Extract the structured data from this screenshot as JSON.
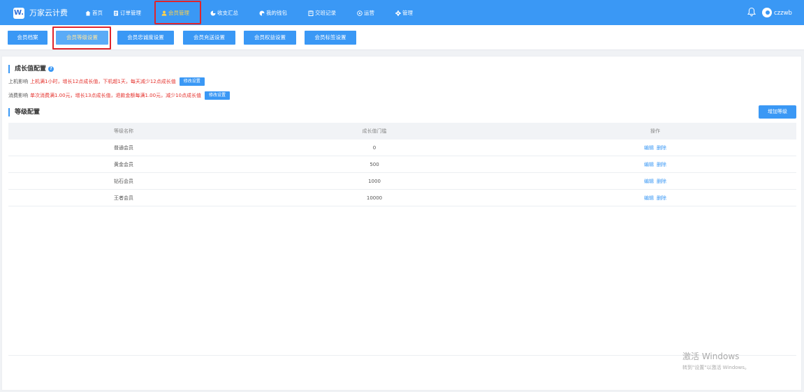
{
  "app": {
    "logo_letter": "W.",
    "name": "万家云计费"
  },
  "nav": {
    "items": [
      {
        "label": "首页",
        "icon": "home-icon"
      },
      {
        "label": "订单管理",
        "icon": "document-icon"
      },
      {
        "label": "会员管理",
        "icon": "user-icon",
        "active": true
      },
      {
        "label": "收支汇总",
        "icon": "chart-icon"
      },
      {
        "label": "我的钱包",
        "icon": "wallet-icon"
      },
      {
        "label": "交班记录",
        "icon": "clipboard-icon"
      },
      {
        "label": "运营",
        "icon": "target-icon"
      },
      {
        "label": "管理",
        "icon": "gear-icon"
      }
    ],
    "username": "czzwb",
    "accent_color": "#3a98f5",
    "active_color": "#ffd24a",
    "highlight_color": "#e0242b"
  },
  "subnav": {
    "items": [
      {
        "label": "会员档案"
      },
      {
        "label": "会员等级设置",
        "active": true
      },
      {
        "label": "会员忠诚度设置"
      },
      {
        "label": "会员充送设置"
      },
      {
        "label": "会员权益设置"
      },
      {
        "label": "会员标签设置"
      }
    ]
  },
  "growth_config": {
    "title": "成长值配置",
    "help_icon": "question-icon",
    "online": {
      "label": "上机影响",
      "rule": "上机满1小时，增长12点成长值，下机超1天，每天减少12点成长值",
      "button": "修改设置"
    },
    "consume": {
      "label": "消费影响",
      "rule": "单次消费满1.00元，增长13点成长值，退款金额每满1.00元，减少10点成长值",
      "button": "修改设置"
    }
  },
  "level_config": {
    "title": "等级配置",
    "add_button": "增加等级",
    "headers": [
      "等级名称",
      "成长值门槛",
      "操作"
    ],
    "rows": [
      {
        "name": "普通会员",
        "threshold": "0",
        "edit": "编辑",
        "delete": "删除"
      },
      {
        "name": "黄金会员",
        "threshold": "500",
        "edit": "编辑",
        "delete": "删除"
      },
      {
        "name": "钻石会员",
        "threshold": "1000",
        "edit": "编辑",
        "delete": "删除"
      },
      {
        "name": "王者会员",
        "threshold": "10000",
        "edit": "编辑",
        "delete": "删除"
      }
    ]
  },
  "watermark": {
    "line1": "激活 Windows",
    "line2": "转到\"设置\"以激活 Windows。"
  }
}
